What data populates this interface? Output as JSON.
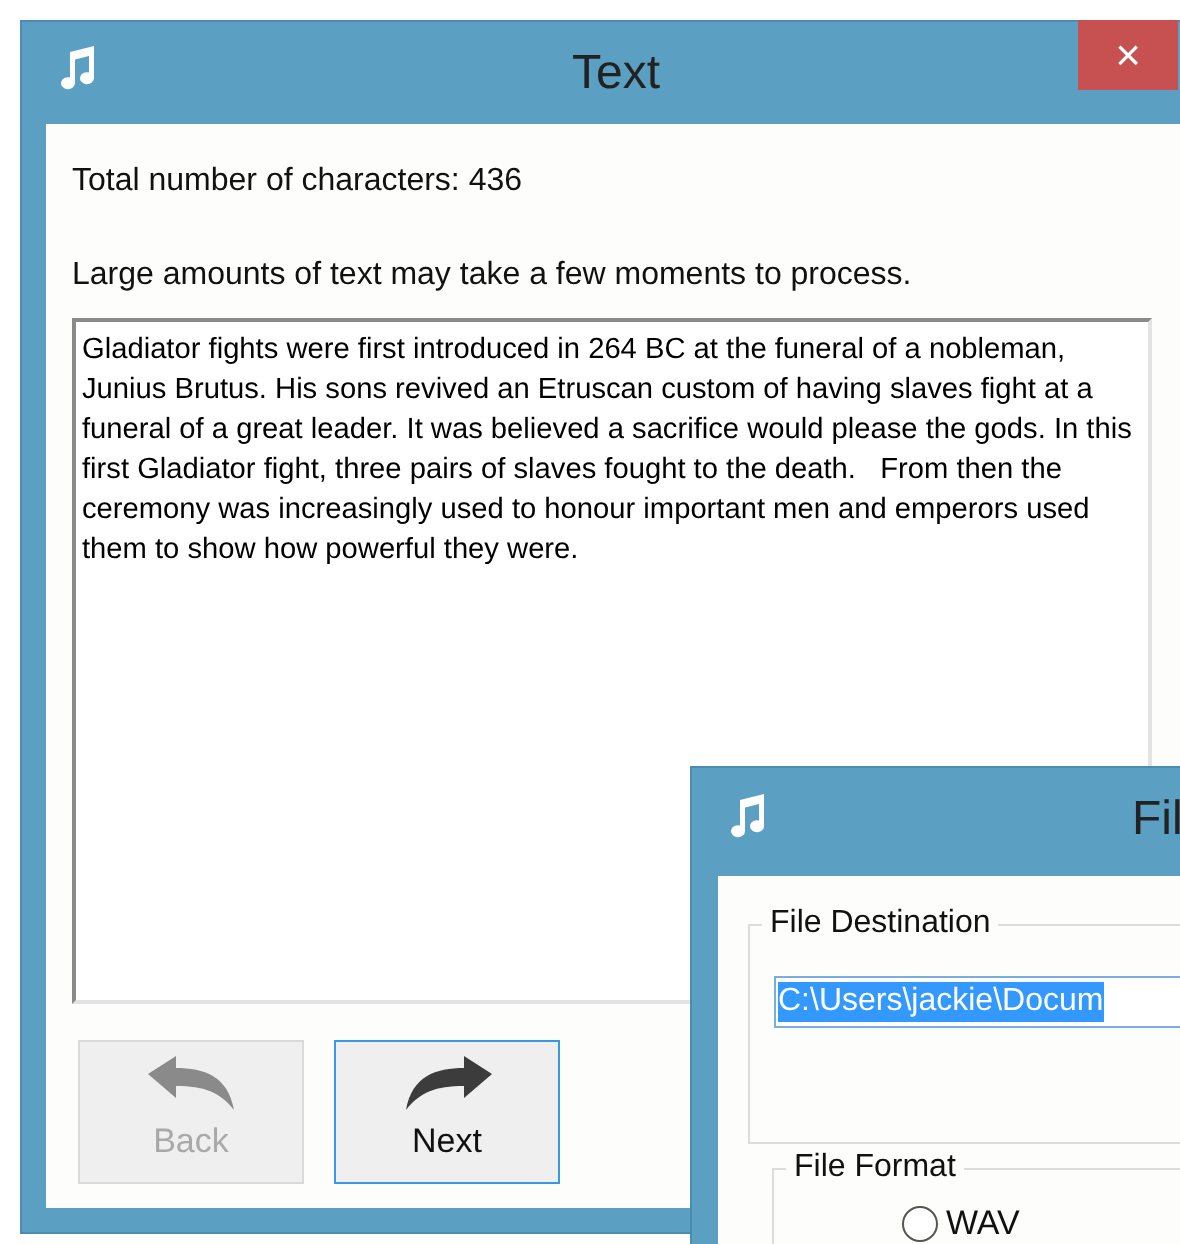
{
  "main_window": {
    "title": "Text",
    "close": "×",
    "character_count": "Total number of characters: 436",
    "notice": "Large amounts of text may take a few moments to process.",
    "text_value": "Gladiator fights were first introduced in 264 BC at the funeral of a nobleman, Junius Brutus. His sons revived an Etruscan custom of having slaves fight at a funeral of a great leader. It was believed a sacrifice would please the gods. In this first Gladiator fight, three pairs of slaves fought to the death.   From then the ceremony was increasingly used to honour important men and emperors used them to show how powerful they were.",
    "buttons": [
      {
        "kind": "back",
        "label": "Back",
        "disabled": true,
        "focused": false
      },
      {
        "kind": "next",
        "label": "Next",
        "disabled": false,
        "focused": true
      }
    ]
  },
  "file_window": {
    "title": "Fil",
    "destination_group": "File Destination",
    "destination_value": "C:\\Users\\jackie\\Docum",
    "format_group": "File Format",
    "formats": [
      {
        "label": "WAV",
        "selected": false
      }
    ]
  }
}
